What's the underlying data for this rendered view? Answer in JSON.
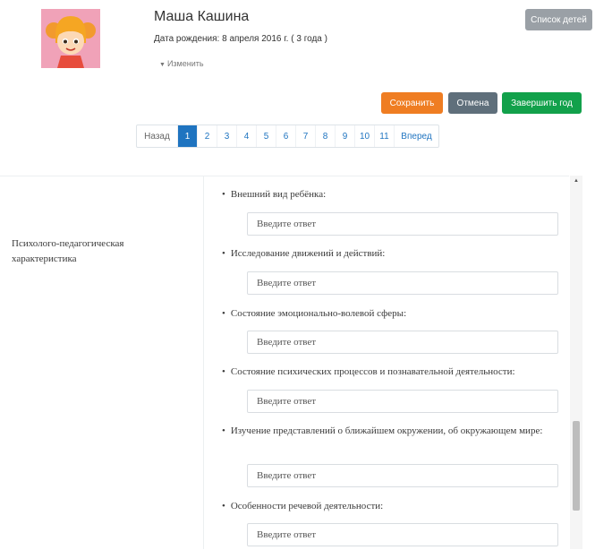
{
  "profile": {
    "name": "Маша Кашина",
    "dob": "Дата рождения: 8 апреля 2016 г. ( 3 года )",
    "edit_label": "Изменить"
  },
  "buttons": {
    "children_list": "Список детей",
    "save": "Сохранить",
    "cancel": "Отмена",
    "finish_year": "Завершить год"
  },
  "pagination": {
    "prev": "Назад",
    "pages": [
      "1",
      "2",
      "3",
      "4",
      "5",
      "6",
      "7",
      "8",
      "9",
      "10",
      "11"
    ],
    "active": "1",
    "next": "Вперед"
  },
  "section": {
    "label": "Психолого-педагогическая характеристика",
    "questions": [
      {
        "text": "Внешний вид ребёнка:",
        "placeholder": "Введите ответ"
      },
      {
        "text": "Исследование движений и действий:",
        "placeholder": "Введите ответ"
      },
      {
        "text": "Состояние эмоционально-волевой сферы:",
        "placeholder": "Введите ответ"
      },
      {
        "text": "Состояние психических процессов и познавательной деятельности:",
        "placeholder": "Введите ответ"
      },
      {
        "text": "Изучение представлений о ближайшем окружении, об окружающем мире:",
        "placeholder": "Введите ответ"
      },
      {
        "text": "Особенности речевой деятельности:",
        "placeholder": "Введите ответ"
      }
    ]
  },
  "colors": {
    "save": "#ef7d22",
    "cancel": "#5f6f7b",
    "finish": "#12a14b",
    "list": "#9aa0a6",
    "active_page": "#1f74c0"
  }
}
